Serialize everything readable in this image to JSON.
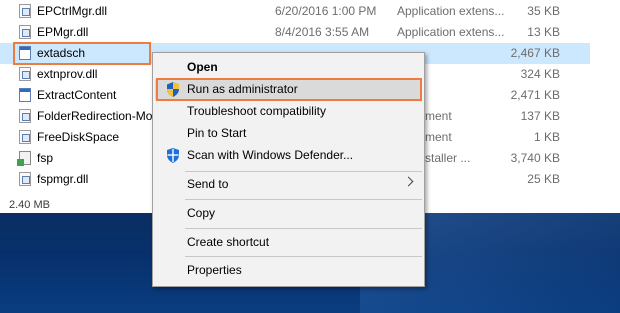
{
  "files": [
    {
      "name": "EPCtrlMgr.dll",
      "date": "6/20/2016 1:00 PM",
      "type": "Application extens...",
      "size": "35 KB",
      "icon": "dll-file-icon"
    },
    {
      "name": "EPMgr.dll",
      "date": "8/4/2016 3:55 AM",
      "type": "Application extens...",
      "size": "13 KB",
      "icon": "dll-file-icon"
    },
    {
      "name": "extadsch",
      "date": "",
      "type": "",
      "size": "2,467 KB",
      "icon": "application-icon",
      "selected": true
    },
    {
      "name": "extnprov.dll",
      "date": "",
      "type": "",
      "size": "324 KB",
      "icon": "dll-file-icon"
    },
    {
      "name": "ExtractContent",
      "date": "",
      "type": "",
      "size": "2,471 KB",
      "icon": "application-icon"
    },
    {
      "name": "FolderRedirection-Mo",
      "date": "",
      "type": "Document",
      "size": "137 KB",
      "icon": "document-icon"
    },
    {
      "name": "FreeDiskSpace",
      "date": "",
      "type": "Document",
      "size": "1 KB",
      "icon": "document-icon"
    },
    {
      "name": "fsp",
      "date": "",
      "type": "ws Installer ...",
      "size": "3,740 KB",
      "icon": "installer-icon"
    },
    {
      "name": "fspmgr.dll",
      "date": "",
      "type": "",
      "size": "25 KB",
      "icon": "dll-file-icon"
    }
  ],
  "status": {
    "text": "2.40 MB"
  },
  "context_menu": {
    "items": [
      {
        "label": "Open",
        "bold": true
      },
      {
        "label": "Run as administrator",
        "icon": "uac-shield-icon",
        "highlighted": true
      },
      {
        "label": "Troubleshoot compatibility"
      },
      {
        "label": "Pin to Start"
      },
      {
        "label": "Scan with Windows Defender...",
        "icon": "windows-defender-icon"
      },
      {
        "label": "Send to",
        "submenu": true
      },
      {
        "label": "Copy"
      },
      {
        "label": "Create shortcut"
      },
      {
        "label": "Properties"
      }
    ]
  },
  "colors": {
    "selection": "#cce8ff",
    "highlight_box": "#f07b3f",
    "desktop": "#0b3570"
  }
}
